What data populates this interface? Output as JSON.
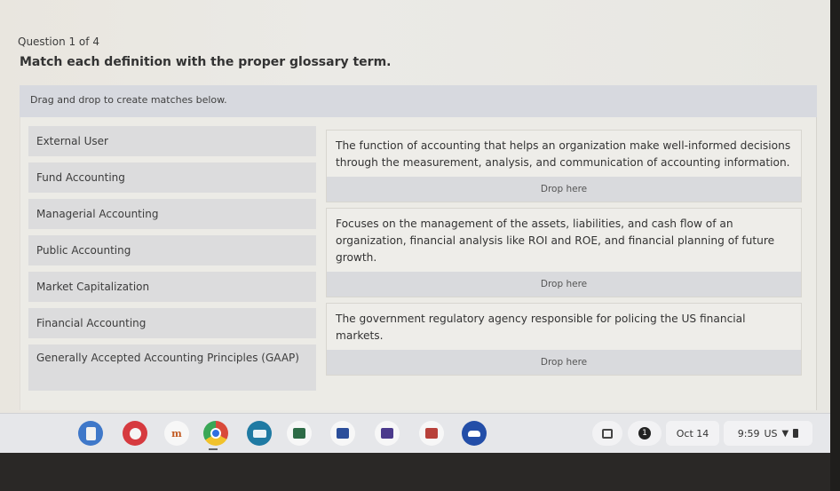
{
  "question": {
    "number_label": "Question 1 of 4",
    "prompt": "Match each definition with the proper glossary term.",
    "instructions": "Drag and drop to create matches below."
  },
  "terms": [
    {
      "label": "External User"
    },
    {
      "label": "Fund Accounting"
    },
    {
      "label": "Managerial Accounting"
    },
    {
      "label": "Public Accounting"
    },
    {
      "label": "Market Capitalization"
    },
    {
      "label": "Financial Accounting"
    },
    {
      "label": "Generally Accepted Accounting Principles (GAAP)"
    }
  ],
  "definitions": [
    {
      "text": "The function of accounting that helps an organization make well-informed decisions through the measurement, analysis, and communication of accounting information.",
      "drop_label": "Drop here"
    },
    {
      "text": "Focuses on the management of the assets, liabilities, and cash flow of an organization, financial analysis like ROI and ROE, and financial planning of future growth.",
      "drop_label": "Drop here"
    },
    {
      "text": "The government regulatory agency responsible for policing the US financial markets.",
      "drop_label": "Drop here"
    }
  ],
  "taskbar": {
    "apps": [
      {
        "name": "files-icon",
        "bg": "#3f78c9",
        "fg": "#f4f4f4",
        "glyph": ""
      },
      {
        "name": "paint-icon",
        "bg": "#d63a3f",
        "fg": "#ffffff",
        "glyph": ""
      },
      {
        "name": "moodle-icon",
        "bg": "#f7f7f7",
        "fg": "#c25a22",
        "glyph": "m"
      },
      {
        "name": "chrome-icon",
        "bg": "#e2e2e2",
        "fg": "#2f6fe0",
        "glyph": ""
      },
      {
        "name": "screencast-icon",
        "bg": "#1f7aa3",
        "fg": "#ffffff",
        "glyph": ""
      },
      {
        "name": "excel-icon",
        "bg": "#f7f7f7",
        "fg": "#2d6b46",
        "glyph": ""
      },
      {
        "name": "word-icon",
        "bg": "#f7f7f7",
        "fg": "#2b4e9a",
        "glyph": ""
      },
      {
        "name": "onenote-icon",
        "bg": "#f7f7f7",
        "fg": "#4b3a8c",
        "glyph": ""
      },
      {
        "name": "powerpoint-icon",
        "bg": "#f7f7f7",
        "fg": "#b8413a",
        "glyph": ""
      },
      {
        "name": "onedrive-icon",
        "bg": "#234ea8",
        "fg": "#ffffff",
        "glyph": ""
      }
    ],
    "tray": {
      "notification_count": "1",
      "date": "Oct 14",
      "time": "9:59",
      "locale": "US"
    }
  }
}
